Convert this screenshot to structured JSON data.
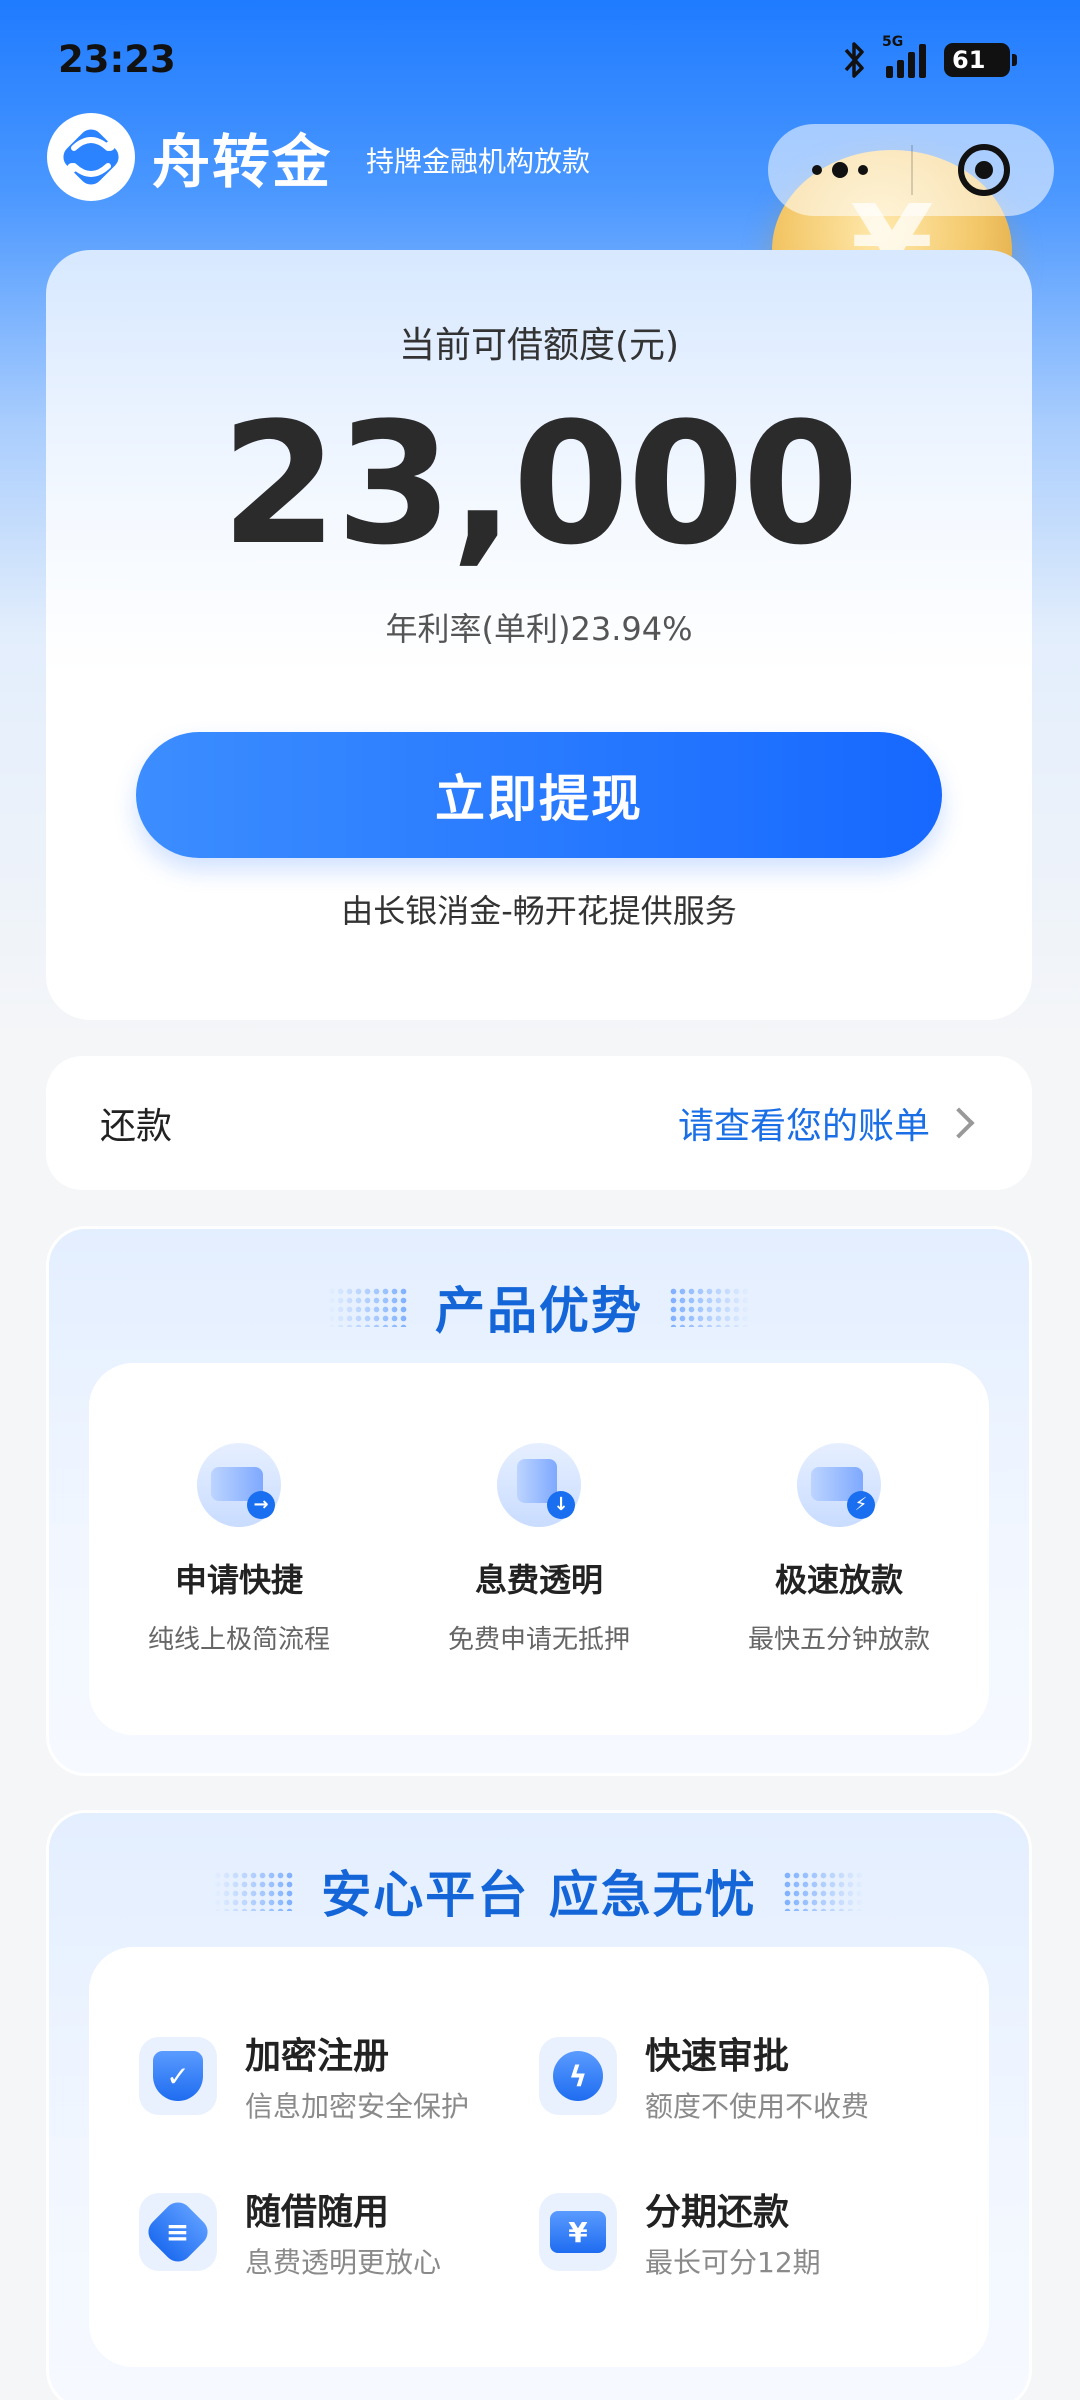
{
  "status_bar": {
    "time": "23:23",
    "network": "5G",
    "battery": "61"
  },
  "header": {
    "brand": "舟转金",
    "tagline": "持牌金融机构放款"
  },
  "credit": {
    "title": "当前可借额度(元)",
    "amount": "23,000",
    "rate": "年利率(单利)23.94%",
    "button_label": "立即提现",
    "provider": "由长银消金-畅开花提供服务"
  },
  "repay": {
    "label": "还款",
    "link": "请查看您的账单"
  },
  "advantages": {
    "title": "产品优势",
    "items": [
      {
        "title": "申请快捷",
        "desc": "纯线上极简流程",
        "icon": "card-arrow-icon"
      },
      {
        "title": "息费透明",
        "desc": "免费申请无抵押",
        "icon": "document-download-icon"
      },
      {
        "title": "极速放款",
        "desc": "最快五分钟放款",
        "icon": "wallet-lightning-icon"
      }
    ]
  },
  "assurance": {
    "title": "安心平台 应急无忧",
    "items": [
      {
        "title": "加密注册",
        "desc": "信息加密安全保护",
        "icon": "shield-check-icon"
      },
      {
        "title": "快速审批",
        "desc": "额度不使用不收费",
        "icon": "lightning-icon"
      },
      {
        "title": "随借随用",
        "desc": "息费透明更放心",
        "icon": "badge-lines-icon"
      },
      {
        "title": "分期还款",
        "desc": "最长可分12期",
        "icon": "yen-ticket-icon"
      }
    ]
  },
  "colors": {
    "primary": "#1668ff",
    "link": "#1a6ee6",
    "section_title": "#1466d8"
  }
}
